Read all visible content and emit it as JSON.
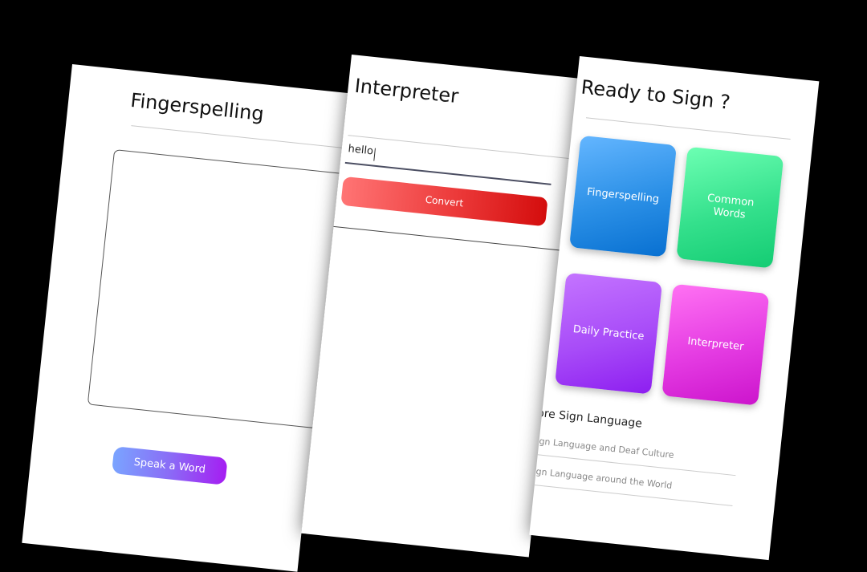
{
  "fingerspelling_screen": {
    "title": "Fingerspelling",
    "speak_button_label": "Speak a Word"
  },
  "interpreter_screen": {
    "title": "Interpreter",
    "input_value": "hello",
    "convert_button_label": "Convert"
  },
  "home_screen": {
    "title": "Ready to Sign ?",
    "tiles": [
      {
        "label": "Fingerspelling",
        "color": "#2a8fe6"
      },
      {
        "label": "Common\nWords",
        "color": "#34e08c"
      },
      {
        "label": "Daily Practice",
        "color": "#a84cf8"
      },
      {
        "label": "Interpreter",
        "color": "#e43be2"
      }
    ],
    "more_section": {
      "title": "More Sign Language",
      "links": [
        "Sign Language and Deaf Culture",
        "Sign Language around the World"
      ]
    }
  },
  "colors": {
    "speak_gradient": [
      "#7aa4ff",
      "#a51ef2"
    ],
    "convert_gradient": [
      "#ff7474",
      "#d40d0d"
    ]
  }
}
